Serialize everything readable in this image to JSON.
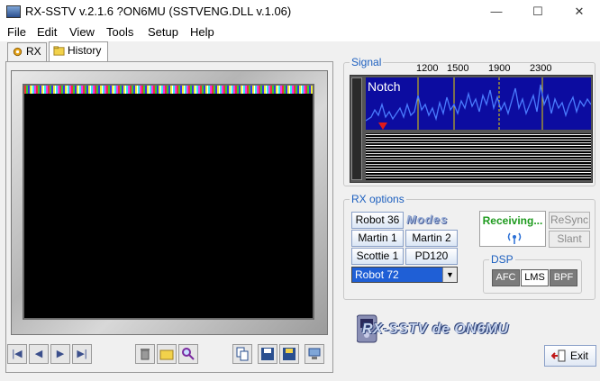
{
  "window": {
    "title": "RX-SSTV v.2.1.6 ?ON6MU (SSTVENG.DLL v.1.06)",
    "minimize_symbol": "—",
    "maximize_symbol": "☐",
    "close_symbol": "✕"
  },
  "menu": [
    "File",
    "Edit",
    "View",
    "Tools",
    "Setup",
    "Help"
  ],
  "tabs": [
    {
      "label": "RX",
      "icon": "gear-icon"
    },
    {
      "label": "History",
      "icon": "folder-icon"
    }
  ],
  "signal": {
    "group_label": "Signal",
    "freq_ticks": [
      "1200",
      "1500",
      "1900",
      "2300"
    ],
    "notch_label": "Notch"
  },
  "rx_options": {
    "group_label": "RX options",
    "mode_buttons": [
      "Robot 36",
      "Martin 1",
      "Martin 2",
      "Scottie 1",
      "PD120"
    ],
    "modes_logo": "Modes",
    "selected_mode": "Robot 72",
    "status": "Receiving...",
    "resync_label": "ReSync",
    "slant_label": "Slant"
  },
  "dsp": {
    "group_label": "DSP",
    "buttons": [
      "AFC",
      "LMS",
      "BPF"
    ],
    "active_color": "#7b7b7b"
  },
  "logo_text": "RX-SSTV de ON6MU",
  "exit_label": "Exit",
  "colors": {
    "accent": "#1c5fbf",
    "receiving": "#1d9a1d",
    "spectrum_bg": "#0c0ca0",
    "select_bg": "#1f5fd6"
  }
}
